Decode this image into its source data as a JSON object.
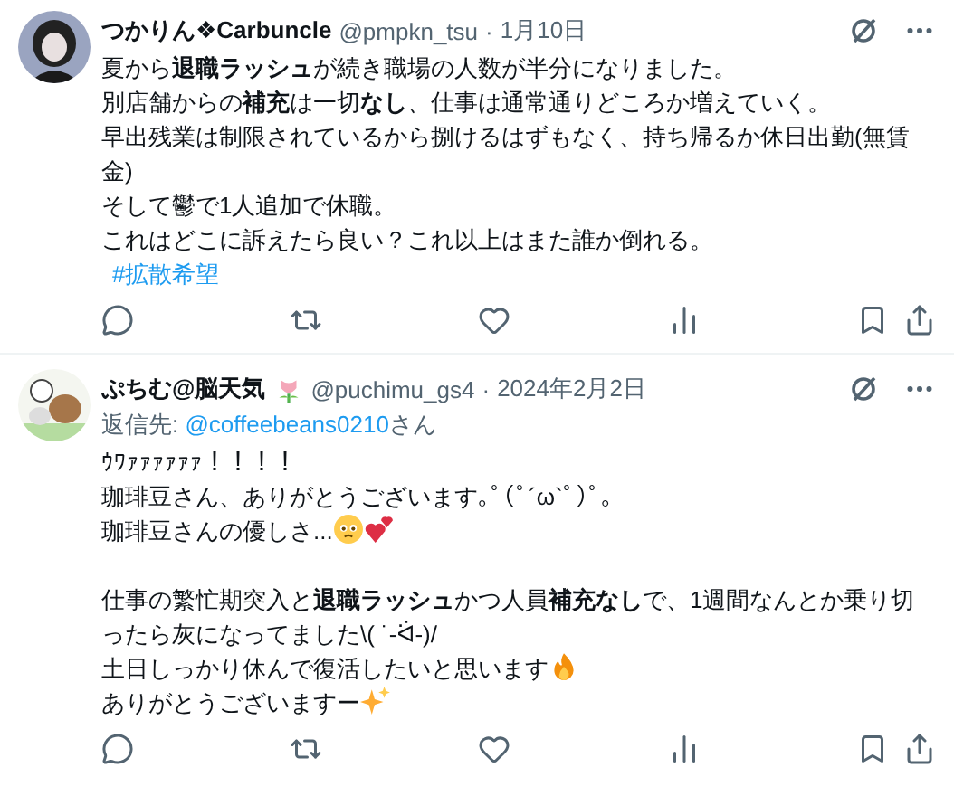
{
  "tweets": [
    {
      "name": [
        {
          "kind": "text",
          "text": "つかりん❖Carbuncle"
        }
      ],
      "handle": "@pmpkn_tsu",
      "dot": "·",
      "date": "1月10日",
      "lines": [
        {
          "parts": [
            {
              "kind": "text",
              "text": "夏から**退職ラッシュ**が続き職場の人数が半分になりました。"
            }
          ]
        },
        {
          "parts": [
            {
              "kind": "text",
              "text": "別店舗からの**補充**は一切**なし**、仕事は通常通りどころか増えていく。"
            }
          ]
        },
        {
          "parts": [
            {
              "kind": "text",
              "text": "早出残業は制限されているから捌けるはずもなく、持ち帰るか休日出勤(無賃金)"
            }
          ]
        },
        {
          "parts": [
            {
              "kind": "text",
              "text": "そして鬱で1人追加で休職。"
            }
          ]
        },
        {
          "parts": [
            {
              "kind": "text",
              "text": "これはどこに訴えたら良い？これ以上はまた誰か倒れる。"
            }
          ]
        },
        {
          "parts": [
            {
              "kind": "hashtag",
              "text": "#拡散希望"
            }
          ]
        }
      ]
    },
    {
      "name": [
        {
          "kind": "text",
          "text": "ぷちむ@脳天気"
        },
        {
          "kind": "tulip"
        }
      ],
      "handle": "@puchimu_gs4",
      "dot": "·",
      "date": "2024年2月2日",
      "reply": {
        "prefix": "返信先: ",
        "link": "@coffeebeans0210",
        "suffix": "さん"
      },
      "lines": [
        {
          "parts": [
            {
              "kind": "text",
              "text": "ｳﾜｧｧｧｧｧｧ！！！！"
            }
          ]
        },
        {
          "parts": [
            {
              "kind": "text",
              "text": "珈琲豆さん、ありがとうございます｡ﾟ(ﾟ´ω`ﾟ)ﾟ｡"
            }
          ]
        },
        {
          "parts": [
            {
              "kind": "text",
              "text": "珈琲豆さんの優しさ..."
            },
            {
              "kind": "pleading"
            },
            {
              "kind": "hearts"
            }
          ]
        },
        {
          "gap_before": true,
          "parts": [
            {
              "kind": "text",
              "text": "仕事の繁忙期突入と**退職ラッシュ**かつ人員**補充なし**で、1週間なんとか乗り切ったら灰になってました\\( ˙-ᐛ-)/"
            }
          ]
        },
        {
          "parts": [
            {
              "kind": "text",
              "text": "土日しっかり休んで復活したいと思います"
            },
            {
              "kind": "fire"
            }
          ]
        },
        {
          "parts": [
            {
              "kind": "text",
              "text": "ありがとうございますー"
            },
            {
              "kind": "sparkles"
            }
          ]
        }
      ]
    }
  ]
}
